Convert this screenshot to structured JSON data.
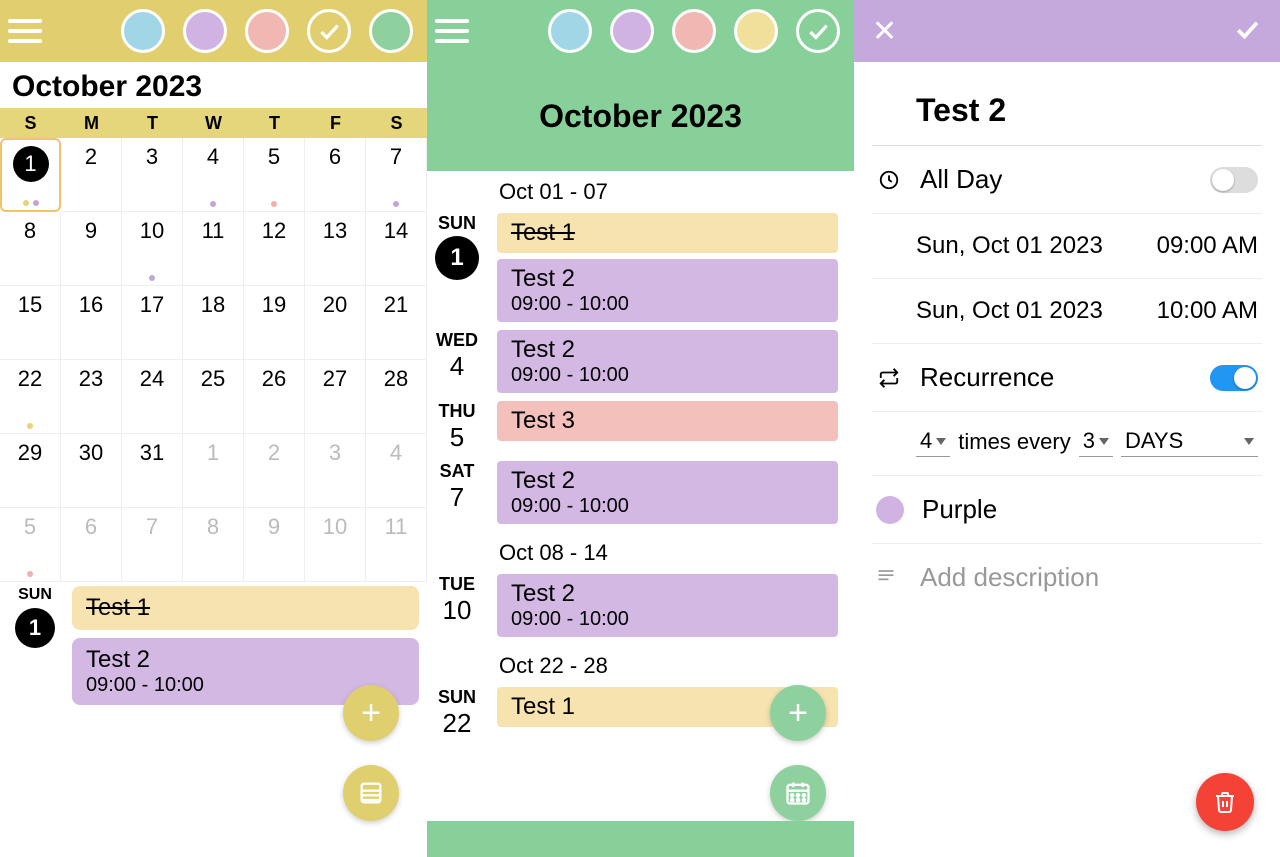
{
  "panel1": {
    "month_title": "October 2023",
    "weekdays": [
      "S",
      "M",
      "T",
      "W",
      "T",
      "F",
      "S"
    ],
    "cells": [
      {
        "d": "1",
        "today": true,
        "dots": [
          "yellow",
          "purple"
        ]
      },
      {
        "d": "2"
      },
      {
        "d": "3"
      },
      {
        "d": "4",
        "dots": [
          "purple"
        ]
      },
      {
        "d": "5",
        "dots": [
          "pink"
        ]
      },
      {
        "d": "6"
      },
      {
        "d": "7",
        "dots": [
          "purple"
        ]
      },
      {
        "d": "8"
      },
      {
        "d": "9"
      },
      {
        "d": "10",
        "dots": [
          "purple"
        ]
      },
      {
        "d": "11"
      },
      {
        "d": "12"
      },
      {
        "d": "13"
      },
      {
        "d": "14"
      },
      {
        "d": "15"
      },
      {
        "d": "16"
      },
      {
        "d": "17"
      },
      {
        "d": "18"
      },
      {
        "d": "19"
      },
      {
        "d": "20"
      },
      {
        "d": "21"
      },
      {
        "d": "22",
        "dots": [
          "yellow"
        ]
      },
      {
        "d": "23"
      },
      {
        "d": "24"
      },
      {
        "d": "25"
      },
      {
        "d": "26"
      },
      {
        "d": "27"
      },
      {
        "d": "28"
      },
      {
        "d": "29"
      },
      {
        "d": "30"
      },
      {
        "d": "31"
      },
      {
        "d": "1",
        "next": true
      },
      {
        "d": "2",
        "next": true
      },
      {
        "d": "3",
        "next": true
      },
      {
        "d": "4",
        "next": true
      },
      {
        "d": "5",
        "next": true,
        "dots": [
          "pink"
        ]
      },
      {
        "d": "6",
        "next": true
      },
      {
        "d": "7",
        "next": true
      },
      {
        "d": "8",
        "next": true
      },
      {
        "d": "9",
        "next": true
      },
      {
        "d": "10",
        "next": true
      },
      {
        "d": "11",
        "next": true
      }
    ],
    "detail": {
      "day_label": "SUN",
      "day_num": "1",
      "events": [
        {
          "title": "Test 1",
          "color": "yellow",
          "strike": true
        },
        {
          "title": "Test 2",
          "time": "09:00 - 10:00",
          "color": "purple"
        }
      ]
    }
  },
  "panel2": {
    "month_banner": "October 2023",
    "weeks": [
      {
        "range": "Oct 01 - 07",
        "days": [
          {
            "label": "SUN",
            "num": "1",
            "today": true,
            "events": [
              {
                "title": "Test 1",
                "color": "yellow",
                "strike": true
              },
              {
                "title": "Test 2",
                "time": "09:00 - 10:00",
                "color": "purple"
              }
            ]
          },
          {
            "label": "WED",
            "num": "4",
            "events": [
              {
                "title": "Test 2",
                "time": "09:00 - 10:00",
                "color": "purple"
              }
            ]
          },
          {
            "label": "THU",
            "num": "5",
            "events": [
              {
                "title": "Test 3",
                "color": "pink"
              }
            ]
          },
          {
            "label": "SAT",
            "num": "7",
            "events": [
              {
                "title": "Test 2",
                "time": "09:00 - 10:00",
                "color": "purple"
              }
            ]
          }
        ]
      },
      {
        "range": "Oct 08 - 14",
        "days": [
          {
            "label": "TUE",
            "num": "10",
            "events": [
              {
                "title": "Test 2",
                "time": "09:00 - 10:00",
                "color": "purple"
              }
            ]
          }
        ]
      },
      {
        "range": "Oct 22 - 28",
        "days": [
          {
            "label": "SUN",
            "num": "22",
            "events": [
              {
                "title": "Test 1",
                "color": "yellow"
              }
            ]
          }
        ]
      }
    ]
  },
  "panel3": {
    "title": "Test 2",
    "all_day_label": "All Day",
    "all_day": false,
    "start_date": "Sun, Oct 01 2023",
    "start_time": "09:00 AM",
    "end_date": "Sun, Oct 01 2023",
    "end_time": "10:00 AM",
    "recurrence_label": "Recurrence",
    "recurrence_on": true,
    "recur_count": "4",
    "recur_times_label": "times every",
    "recur_interval": "3",
    "recur_unit": "DAYS",
    "color_name": "Purple",
    "description_placeholder": "Add description"
  }
}
